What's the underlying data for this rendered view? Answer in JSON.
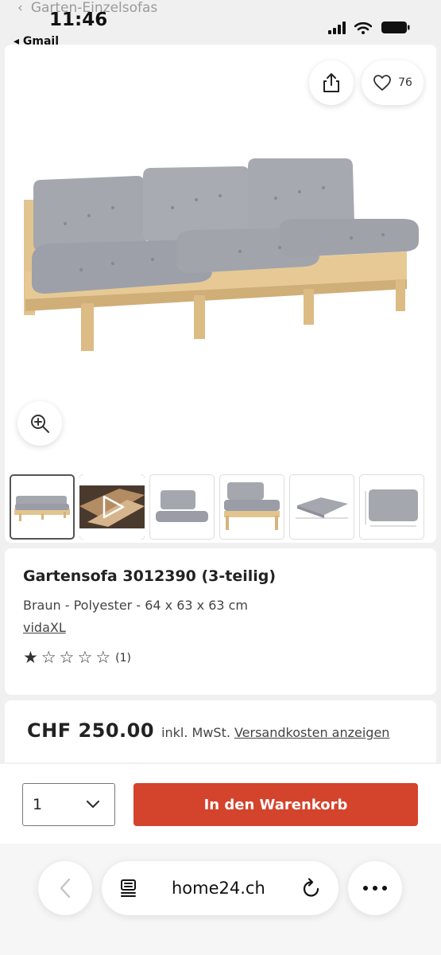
{
  "status_bar": {
    "ghost_title": "Garten-Einzelsofas",
    "time": "11:46",
    "back_app": "◂ Gmail"
  },
  "gallery": {
    "favorite_count": "76",
    "thumbnails": [
      "sofa-3-seat",
      "video",
      "cushion-set",
      "single-seat",
      "seat-cushion",
      "back-cushion"
    ]
  },
  "product": {
    "title": "Gartensofa 3012390 (3-teilig)",
    "subtitle": "Braun - Polyester - 64 x 63 x 63 cm",
    "brand": "vidaXL",
    "rating": 1,
    "rating_max": 5,
    "review_count": "(1)"
  },
  "price": {
    "amount": "CHF 250.00",
    "vat_note": "inkl. MwSt.",
    "shipping_link": "Versandkosten anzeigen"
  },
  "cart": {
    "quantity": "1",
    "button_label": "In den Warenkorb",
    "button_color": "#d4432c"
  },
  "browser": {
    "url": "home24.ch"
  }
}
